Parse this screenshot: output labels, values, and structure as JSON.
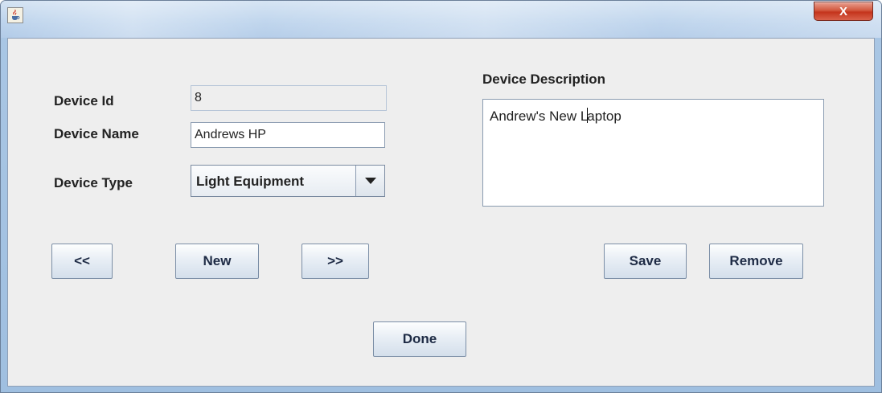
{
  "window": {
    "icon": "java-cup-icon",
    "close_glyph": "X"
  },
  "form": {
    "device_id_label": "Device Id",
    "device_id_value": "8",
    "device_name_label": "Device Name",
    "device_name_value": "Andrews HP",
    "device_type_label": "Device Type",
    "device_type_value": "Light Equipment",
    "description_label": "Device Description",
    "description_before_caret": "Andrew's New L",
    "description_after_caret": "aptop"
  },
  "buttons": {
    "prev": "<<",
    "new": "New",
    "next": ">>",
    "save": "Save",
    "remove": "Remove",
    "done": "Done"
  },
  "colors": {
    "panel": "#eeeeee",
    "frame": "#b7d0ea",
    "close": "#c4341c"
  }
}
